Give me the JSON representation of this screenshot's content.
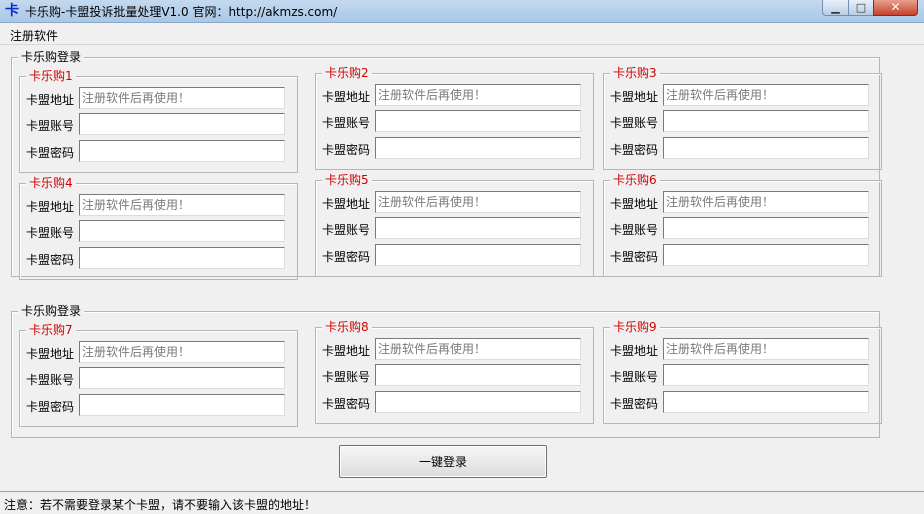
{
  "window": {
    "title": "卡乐购-卡盟投诉批量处理V1.0 官网：http://akmzs.com/",
    "icon_char": "卡",
    "minimize_symbol": "▁",
    "maximize_symbol": "□",
    "close_symbol": "✕"
  },
  "menu": {
    "register": "注册软件"
  },
  "groups": [
    {
      "title": "卡乐购登录"
    },
    {
      "title": "卡乐购登录"
    }
  ],
  "accounts": [
    {
      "title": "卡乐购1",
      "address_label": "卡盟地址",
      "address_placeholder": "注册软件后再使用！",
      "account_label": "卡盟账号",
      "password_label": "卡盟密码"
    },
    {
      "title": "卡乐购2",
      "address_label": "卡盟地址",
      "address_placeholder": "注册软件后再使用！",
      "account_label": "卡盟账号",
      "password_label": "卡盟密码"
    },
    {
      "title": "卡乐购3",
      "address_label": "卡盟地址",
      "address_placeholder": "注册软件后再使用！",
      "account_label": "卡盟账号",
      "password_label": "卡盟密码"
    },
    {
      "title": "卡乐购4",
      "address_label": "卡盟地址",
      "address_placeholder": "注册软件后再使用！",
      "account_label": "卡盟账号",
      "password_label": "卡盟密码"
    },
    {
      "title": "卡乐购5",
      "address_label": "卡盟地址",
      "address_placeholder": "注册软件后再使用！",
      "account_label": "卡盟账号",
      "password_label": "卡盟密码"
    },
    {
      "title": "卡乐购6",
      "address_label": "卡盟地址",
      "address_placeholder": "注册软件后再使用！",
      "account_label": "卡盟账号",
      "password_label": "卡盟密码"
    },
    {
      "title": "卡乐购7",
      "address_label": "卡盟地址",
      "address_placeholder": "注册软件后再使用！",
      "account_label": "卡盟账号",
      "password_label": "卡盟密码"
    },
    {
      "title": "卡乐购8",
      "address_label": "卡盟地址",
      "address_placeholder": "注册软件后再使用！",
      "account_label": "卡盟账号",
      "password_label": "卡盟密码"
    },
    {
      "title": "卡乐购9",
      "address_label": "卡盟地址",
      "address_placeholder": "注册软件后再使用！",
      "account_label": "卡盟账号",
      "password_label": "卡盟密码"
    }
  ],
  "login_button": "一键登录",
  "status": "注意：若不需要登录某个卡盟，请不要输入该卡盟的地址！",
  "colors": {
    "subgroup_title": "#d00000",
    "titlebar": "#b9d1ea"
  }
}
